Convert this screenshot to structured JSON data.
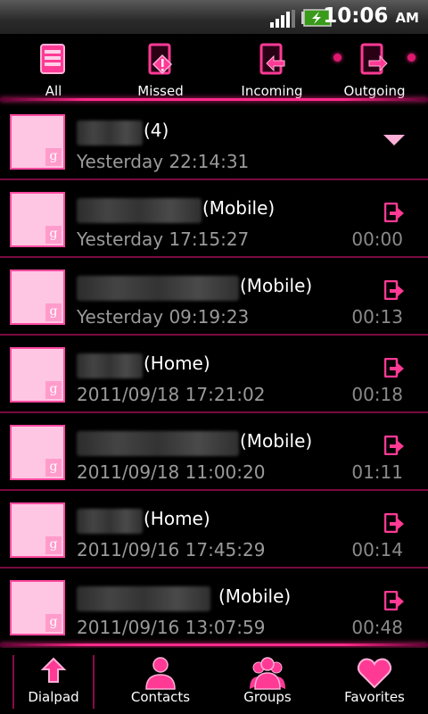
{
  "status_bar": {
    "time": "10:06",
    "ampm": "AM"
  },
  "tabs": [
    {
      "label": "All"
    },
    {
      "label": "Missed"
    },
    {
      "label": "Incoming"
    },
    {
      "label": "Outgoing"
    }
  ],
  "calls": [
    {
      "suffix": "(4)",
      "time": "Yesterday 22:14:31",
      "duration": "",
      "has_expand": true
    },
    {
      "suffix": "(Mobile)",
      "time": "Yesterday 17:15:27",
      "duration": "00:00"
    },
    {
      "suffix": "(Mobile)",
      "time": "Yesterday 09:19:23",
      "duration": "00:13"
    },
    {
      "suffix": "(Home)",
      "time": "2011/09/18  17:21:02",
      "duration": "00:18"
    },
    {
      "suffix": "(Mobile)",
      "time": "2011/09/18  11:00:20",
      "duration": "01:11"
    },
    {
      "suffix": "(Home)",
      "time": "2011/09/16  17:45:29",
      "duration": "00:14"
    },
    {
      "suffix": "(Mobile)",
      "time": "2011/09/16  13:07:59",
      "duration": "00:48"
    }
  ],
  "bottom_nav": [
    {
      "label": "Dialpad"
    },
    {
      "label": "Contacts"
    },
    {
      "label": "Groups"
    },
    {
      "label": "Favorites"
    }
  ],
  "colors": {
    "accent": "#ff2a8a",
    "avatar_bg": "#ffc6e3",
    "separator": "#7a0a40"
  }
}
